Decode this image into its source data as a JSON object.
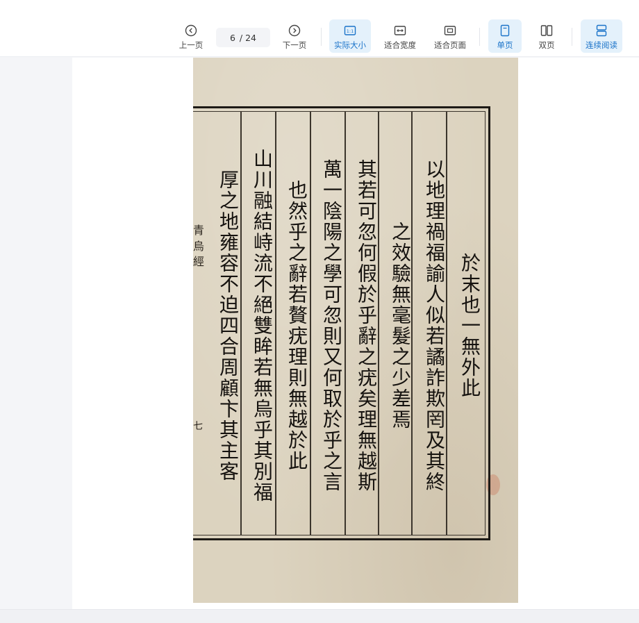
{
  "toolbar": {
    "prev_label": "上一页",
    "next_label": "下一页",
    "current_page": "6",
    "total_pages": "/ 24",
    "actual_size_label": "实际大小",
    "actual_size_icon_text": "1:1",
    "fit_width_label": "适合宽度",
    "fit_page_label": "适合页面",
    "single_page_label": "单页",
    "double_page_label": "双页",
    "continuous_label": "连续阅读"
  },
  "document": {
    "columns": [
      "於末也一無外此",
      "以地理禍福諭人似若譎詐欺罔及其終",
      "之效驗無毫髮之少差焉",
      "其若可忽何假於乎辭之疣矣理無越斯",
      "萬一陰陽之學可忽則又何取於乎之言",
      "也然乎之辭若贅疣理則無越於此",
      "山川融結峙流不絕雙眸若無烏乎其別福",
      "厚之地雍容不迫四合周顧卞其主客"
    ],
    "margin_marks": [
      "青",
      "烏",
      "經",
      "七"
    ]
  },
  "colors": {
    "accent": "#1a73c9",
    "active_bg": "#e4f1fb",
    "paper": "#dcd3bf"
  }
}
